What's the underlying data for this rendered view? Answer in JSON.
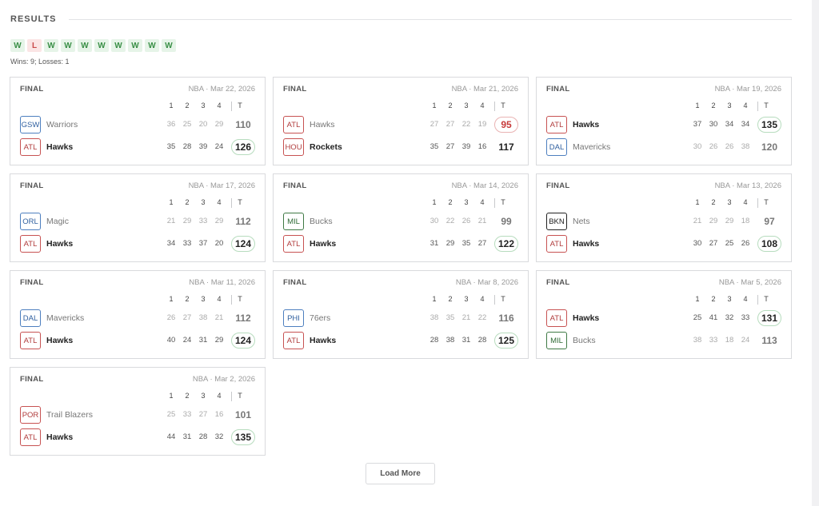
{
  "section": {
    "title": "RESULTS"
  },
  "form": [
    "W",
    "L",
    "W",
    "W",
    "W",
    "W",
    "W",
    "W",
    "W",
    "W"
  ],
  "record": "Wins: 9; Losses: 1",
  "quarter_headers": [
    "1",
    "2",
    "3",
    "4",
    "T"
  ],
  "colors": {
    "win": "#2f8f45",
    "loss": "#c73a3a",
    "win_pill_bg": "#e6f4e8",
    "loss_pill_bg": "#fbe5e5"
  },
  "games": [
    {
      "status": "FINAL",
      "meta": "NBA · Mar 22, 2026",
      "result": "win",
      "teams": [
        {
          "abbr": "GSW",
          "name": "Warriors",
          "color": "blue",
          "quarters": [
            "36",
            "25",
            "20",
            "29"
          ],
          "total": "110",
          "winner": false
        },
        {
          "abbr": "ATL",
          "name": "Hawks",
          "color": "red",
          "quarters": [
            "35",
            "28",
            "39",
            "24"
          ],
          "total": "126",
          "winner": true,
          "atl": true
        }
      ]
    },
    {
      "status": "FINAL",
      "meta": "NBA · Mar 21, 2026",
      "result": "loss",
      "teams": [
        {
          "abbr": "ATL",
          "name": "Hawks",
          "color": "red",
          "quarters": [
            "27",
            "27",
            "22",
            "19"
          ],
          "total": "95",
          "winner": false,
          "atl": true
        },
        {
          "abbr": "HOU",
          "name": "Rockets",
          "color": "red",
          "quarters": [
            "35",
            "27",
            "39",
            "16"
          ],
          "total": "117",
          "winner": true
        }
      ]
    },
    {
      "status": "FINAL",
      "meta": "NBA · Mar 19, 2026",
      "result": "win",
      "teams": [
        {
          "abbr": "ATL",
          "name": "Hawks",
          "color": "red",
          "quarters": [
            "37",
            "30",
            "34",
            "34"
          ],
          "total": "135",
          "winner": true,
          "atl": true
        },
        {
          "abbr": "DAL",
          "name": "Mavericks",
          "color": "blue",
          "quarters": [
            "30",
            "26",
            "26",
            "38"
          ],
          "total": "120",
          "winner": false
        }
      ]
    },
    {
      "status": "FINAL",
      "meta": "NBA · Mar 17, 2026",
      "result": "win",
      "teams": [
        {
          "abbr": "ORL",
          "name": "Magic",
          "color": "blue",
          "quarters": [
            "21",
            "29",
            "33",
            "29"
          ],
          "total": "112",
          "winner": false
        },
        {
          "abbr": "ATL",
          "name": "Hawks",
          "color": "red",
          "quarters": [
            "34",
            "33",
            "37",
            "20"
          ],
          "total": "124",
          "winner": true,
          "atl": true
        }
      ]
    },
    {
      "status": "FINAL",
      "meta": "NBA · Mar 14, 2026",
      "result": "win",
      "teams": [
        {
          "abbr": "MIL",
          "name": "Bucks",
          "color": "green",
          "quarters": [
            "30",
            "22",
            "26",
            "21"
          ],
          "total": "99",
          "winner": false
        },
        {
          "abbr": "ATL",
          "name": "Hawks",
          "color": "red",
          "quarters": [
            "31",
            "29",
            "35",
            "27"
          ],
          "total": "122",
          "winner": true,
          "atl": true
        }
      ]
    },
    {
      "status": "FINAL",
      "meta": "NBA · Mar 13, 2026",
      "result": "win",
      "teams": [
        {
          "abbr": "BKN",
          "name": "Nets",
          "color": "dark",
          "quarters": [
            "21",
            "29",
            "29",
            "18"
          ],
          "total": "97",
          "winner": false
        },
        {
          "abbr": "ATL",
          "name": "Hawks",
          "color": "red",
          "quarters": [
            "30",
            "27",
            "25",
            "26"
          ],
          "total": "108",
          "winner": true,
          "atl": true
        }
      ]
    },
    {
      "status": "FINAL",
      "meta": "NBA · Mar 11, 2026",
      "result": "win",
      "teams": [
        {
          "abbr": "DAL",
          "name": "Mavericks",
          "color": "blue",
          "quarters": [
            "26",
            "27",
            "38",
            "21"
          ],
          "total": "112",
          "winner": false
        },
        {
          "abbr": "ATL",
          "name": "Hawks",
          "color": "red",
          "quarters": [
            "40",
            "24",
            "31",
            "29"
          ],
          "total": "124",
          "winner": true,
          "atl": true
        }
      ]
    },
    {
      "status": "FINAL",
      "meta": "NBA · Mar 8, 2026",
      "result": "win",
      "teams": [
        {
          "abbr": "PHI",
          "name": "76ers",
          "color": "blue",
          "quarters": [
            "38",
            "35",
            "21",
            "22"
          ],
          "total": "116",
          "winner": false
        },
        {
          "abbr": "ATL",
          "name": "Hawks",
          "color": "red",
          "quarters": [
            "28",
            "38",
            "31",
            "28"
          ],
          "total": "125",
          "winner": true,
          "atl": true
        }
      ]
    },
    {
      "status": "FINAL",
      "meta": "NBA · Mar 5, 2026",
      "result": "win",
      "teams": [
        {
          "abbr": "ATL",
          "name": "Hawks",
          "color": "red",
          "quarters": [
            "25",
            "41",
            "32",
            "33"
          ],
          "total": "131",
          "winner": true,
          "atl": true
        },
        {
          "abbr": "MIL",
          "name": "Bucks",
          "color": "green",
          "quarters": [
            "38",
            "33",
            "18",
            "24"
          ],
          "total": "113",
          "winner": false
        }
      ]
    },
    {
      "status": "FINAL",
      "meta": "NBA · Mar 2, 2026",
      "result": "win",
      "teams": [
        {
          "abbr": "POR",
          "name": "Trail Blazers",
          "color": "red",
          "quarters": [
            "25",
            "33",
            "27",
            "16"
          ],
          "total": "101",
          "winner": false
        },
        {
          "abbr": "ATL",
          "name": "Hawks",
          "color": "red",
          "quarters": [
            "44",
            "31",
            "28",
            "32"
          ],
          "total": "135",
          "winner": true,
          "atl": true
        }
      ]
    }
  ],
  "load_more_label": "Load More"
}
